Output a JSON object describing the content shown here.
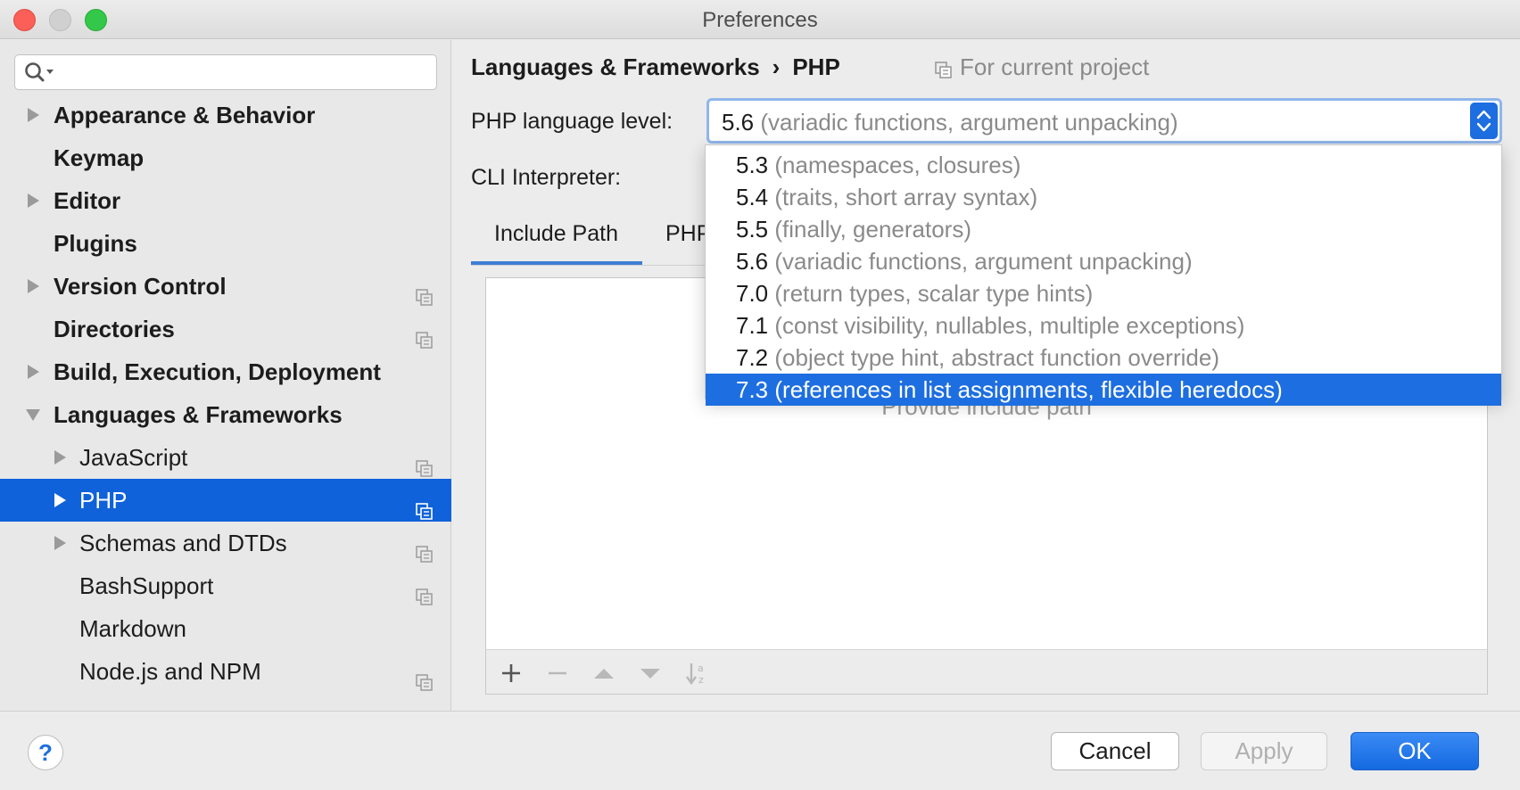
{
  "window": {
    "title": "Preferences"
  },
  "sidebar": {
    "search_placeholder": "",
    "items": [
      {
        "label": "Appearance & Behavior",
        "expandable": true,
        "expanded": false,
        "level": 0,
        "project_icon": false
      },
      {
        "label": "Keymap",
        "expandable": false,
        "level": 0,
        "project_icon": false
      },
      {
        "label": "Editor",
        "expandable": true,
        "expanded": false,
        "level": 0,
        "project_icon": false
      },
      {
        "label": "Plugins",
        "expandable": false,
        "level": 0,
        "project_icon": false
      },
      {
        "label": "Version Control",
        "expandable": true,
        "expanded": false,
        "level": 0,
        "project_icon": true
      },
      {
        "label": "Directories",
        "expandable": false,
        "level": 0,
        "project_icon": true
      },
      {
        "label": "Build, Execution, Deployment",
        "expandable": true,
        "expanded": false,
        "level": 0,
        "project_icon": false
      },
      {
        "label": "Languages & Frameworks",
        "expandable": true,
        "expanded": true,
        "level": 0,
        "project_icon": false
      },
      {
        "label": "JavaScript",
        "expandable": true,
        "expanded": false,
        "level": 1,
        "project_icon": true
      },
      {
        "label": "PHP",
        "expandable": true,
        "expanded": false,
        "level": 1,
        "project_icon": true,
        "selected": true
      },
      {
        "label": "Schemas and DTDs",
        "expandable": true,
        "expanded": false,
        "level": 1,
        "project_icon": true
      },
      {
        "label": "BashSupport",
        "expandable": false,
        "level": 1,
        "project_icon": true
      },
      {
        "label": "Markdown",
        "expandable": false,
        "level": 1,
        "project_icon": false
      },
      {
        "label": "Node.js and NPM",
        "expandable": false,
        "level": 1,
        "project_icon": true
      }
    ]
  },
  "breadcrumb": {
    "parent": "Languages & Frameworks",
    "separator": "›",
    "current": "PHP",
    "scope": "For current project"
  },
  "form": {
    "language_level_label": "PHP language level:",
    "language_level_value": {
      "version": "5.6",
      "description": "(variadic functions, argument unpacking)"
    },
    "cli_interpreter_label": "CLI Interpreter:"
  },
  "tabs": [
    {
      "label": "Include Path",
      "active": true
    },
    {
      "label": "PHP",
      "active": false
    }
  ],
  "include_path": {
    "empty_text": "Provide include path"
  },
  "dropdown": {
    "options": [
      {
        "version": "5.3",
        "description": "(namespaces, closures)"
      },
      {
        "version": "5.4",
        "description": "(traits, short array syntax)"
      },
      {
        "version": "5.5",
        "description": "(finally, generators)"
      },
      {
        "version": "5.6",
        "description": "(variadic functions, argument unpacking)"
      },
      {
        "version": "7.0",
        "description": "(return types, scalar type hints)"
      },
      {
        "version": "7.1",
        "description": "(const visibility, nullables, multiple exceptions)"
      },
      {
        "version": "7.2",
        "description": "(object type hint, abstract function override)"
      },
      {
        "version": "7.3",
        "description": "(references in list assignments, flexible heredocs)",
        "highlighted": true
      }
    ]
  },
  "footer": {
    "help_label": "?",
    "cancel_label": "Cancel",
    "apply_label": "Apply",
    "ok_label": "OK"
  },
  "colors": {
    "accent": "#1d6ee0",
    "selection": "#0f62d9",
    "muted_text": "#8a8a8a"
  }
}
